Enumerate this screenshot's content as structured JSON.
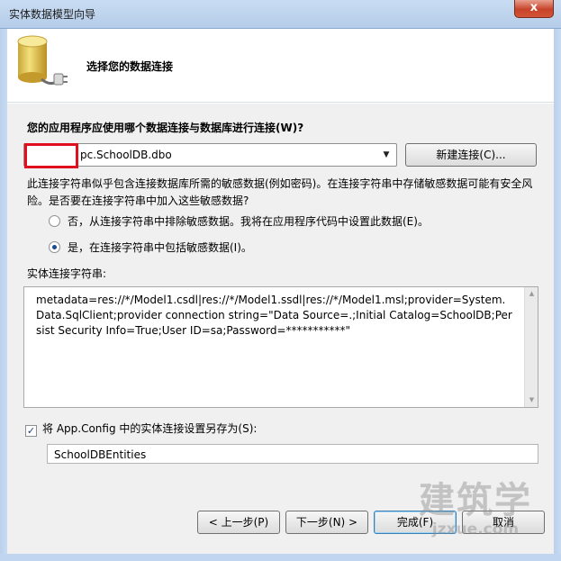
{
  "window": {
    "title": "实体数据模型向导",
    "close_label": "x"
  },
  "header": {
    "heading": "选择您的数据连接"
  },
  "connection": {
    "question": "您的应用程序应使用哪个数据连接与数据库进行连接(W)?",
    "selected_value": "pc.SchoolDB.dbo",
    "new_connection_label": "新建连接(C)..."
  },
  "sensitive": {
    "warning": "此连接字符串似乎包含连接数据库所需的敏感数据(例如密码)。在连接字符串中存储敏感数据可能有安全风险。是否要在连接字符串中加入这些敏感数据?",
    "option_exclude": "否，从连接字符串中排除敏感数据。我将在应用程序代码中设置此数据(E)。",
    "option_include": "是，在连接字符串中包括敏感数据(I)。",
    "selected": "include"
  },
  "entity_connection": {
    "label": "实体连接字符串:",
    "value": "metadata=res://*/Model1.csdl|res://*/Model1.ssdl|res://*/Model1.msl;provider=System.Data.SqlClient;provider connection string=\"Data Source=.;Initial Catalog=SchoolDB;Persist Security Info=True;User ID=sa;Password=***********\""
  },
  "save_config": {
    "label": "将 App.Config 中的实体连接设置另存为(S):",
    "checked": true,
    "value": "SchoolDBEntities"
  },
  "footer": {
    "prev_label": "< 上一步(P)",
    "next_label": "下一步(N) >",
    "finish_label": "完成(F)",
    "cancel_label": "取消"
  },
  "watermark": {
    "big": "建筑学",
    "small": "jzxue.com"
  }
}
